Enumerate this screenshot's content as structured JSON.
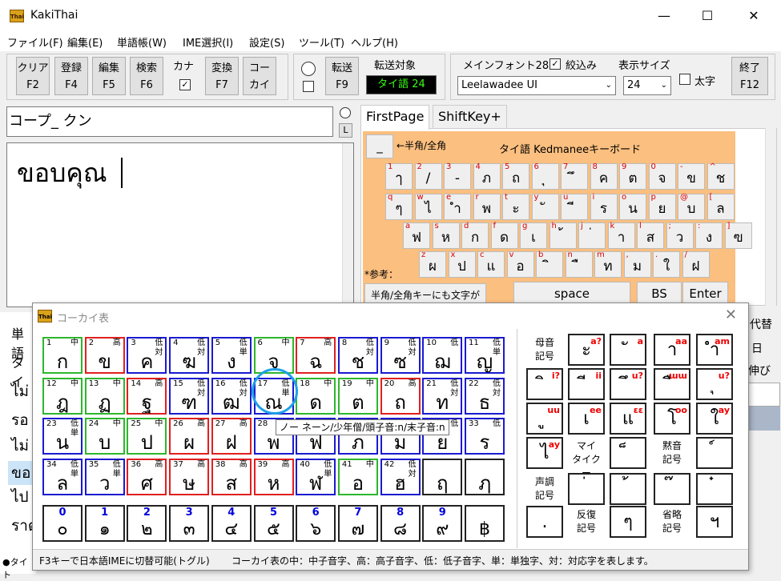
{
  "window": {
    "app_icon": "Thai",
    "title": "KakiThai",
    "min": "—",
    "max": "☐",
    "close": "✕"
  },
  "menu": [
    "ファイル(F)",
    "編集(E)",
    "単語帳(W)",
    "IME選択(I)",
    "設定(S)",
    "ツール(T)",
    "ヘルプ(H)"
  ],
  "toolbar": {
    "clear": [
      "クリア",
      "F2"
    ],
    "register": [
      "登録",
      "F4"
    ],
    "edit": [
      "編集",
      "F5"
    ],
    "search": [
      "検索",
      "F6"
    ],
    "kana": "カナ",
    "convert": [
      "変換",
      "F7"
    ],
    "kokai": [
      "コー",
      "カイ"
    ],
    "transfer": [
      "転送",
      "F9"
    ],
    "transfer_target_label": "転送対象",
    "transfer_target": "タイ語 24",
    "main_font_label": "メインフォント28",
    "filter_label": "絞込み",
    "font_value": "Leelawadee UI",
    "display_size_label": "表示サイズ",
    "size_value": "24",
    "bold_label": "太字",
    "exit": [
      "終了",
      "F12"
    ]
  },
  "input": {
    "reading": "コープ_ クン",
    "l_button": "L",
    "editor_text": "ขอบคุณ"
  },
  "tabs": [
    "FirstPage",
    "ShiftKey+"
  ],
  "keyboard": {
    "toggle_btn": "_",
    "hankaku_label": "←半角/全角",
    "title": "タイ語 Kedmaneeキーボード",
    "reference": "*参考：",
    "hankaku_note": "半角/全角キーにも文字が",
    "space": "space",
    "bs": "BS",
    "enter": "Enter",
    "row1": [
      [
        "1",
        "ๅ"
      ],
      [
        "2",
        "/"
      ],
      [
        "3",
        "-"
      ],
      [
        "4",
        "ภ"
      ],
      [
        "5",
        "ถ"
      ],
      [
        "6",
        "ุ"
      ],
      [
        "7",
        "ึ"
      ],
      [
        "8",
        "ค"
      ],
      [
        "9",
        "ต"
      ],
      [
        "0",
        "จ"
      ],
      [
        "-",
        "ข"
      ],
      [
        "^",
        "ช"
      ]
    ],
    "row2": [
      [
        "q",
        "ๆ"
      ],
      [
        "w",
        "ไ"
      ],
      [
        "e",
        "ำ"
      ],
      [
        "r",
        "พ"
      ],
      [
        "t",
        "ะ"
      ],
      [
        "y",
        "ั"
      ],
      [
        "u",
        "ี"
      ],
      [
        "i",
        "ร"
      ],
      [
        "o",
        "น"
      ],
      [
        "p",
        "ย"
      ],
      [
        "@",
        "บ"
      ],
      [
        "[",
        "ล"
      ]
    ],
    "row3": [
      [
        "a",
        "ฟ"
      ],
      [
        "s",
        "ห"
      ],
      [
        "d",
        "ก"
      ],
      [
        "f",
        "ด"
      ],
      [
        "g",
        "เ"
      ],
      [
        "h",
        "้"
      ],
      [
        "j",
        "่"
      ],
      [
        "k",
        "า"
      ],
      [
        "l",
        "ส"
      ],
      [
        ";",
        "ว"
      ],
      [
        ":",
        "ง"
      ],
      [
        "]",
        "ฃ"
      ]
    ],
    "row4": [
      [
        "z",
        "ผ"
      ],
      [
        "x",
        "ป"
      ],
      [
        "c",
        "แ"
      ],
      [
        "v",
        "อ"
      ],
      [
        "b",
        "ิ"
      ],
      [
        "n",
        "ื"
      ],
      [
        "m",
        "ท"
      ],
      [
        ",",
        "ม"
      ],
      [
        ".",
        "ใ"
      ],
      [
        "/",
        "ฝ"
      ]
    ]
  },
  "left_list": [
    "単語",
    "タイ",
    "ไม่",
    "รอ",
    "ไม่",
    "ขอ",
    "ไป",
    "ราต",
    "●タイト"
  ],
  "right_strip": [
    "代替",
    "日",
    "伸び"
  ],
  "dialog": {
    "title": "コーカイ表",
    "consonants": [
      [
        "1",
        "中",
        "ก",
        "G"
      ],
      [
        "2",
        "高",
        "ข",
        "R"
      ],
      [
        "3",
        "低対",
        "ค",
        "B"
      ],
      [
        "4",
        "低対",
        "ฆ",
        "B"
      ],
      [
        "5",
        "低単",
        "ง",
        "B"
      ],
      [
        "6",
        "中",
        "จ",
        "G"
      ],
      [
        "7",
        "高",
        "ฉ",
        "R"
      ],
      [
        "8",
        "低対",
        "ช",
        "B"
      ],
      [
        "9",
        "低対",
        "ซ",
        "B"
      ],
      [
        "10",
        "低",
        "ฌ",
        "B"
      ],
      [
        "11",
        "低単",
        "ญ",
        "B"
      ],
      [
        "12",
        "中",
        "ฎ",
        "G"
      ],
      [
        "13",
        "中",
        "ฏ",
        "G"
      ],
      [
        "14",
        "高",
        "ฐ",
        "R"
      ],
      [
        "15",
        "低対",
        "ฑ",
        "B"
      ],
      [
        "16",
        "低対",
        "ฒ",
        "B"
      ],
      [
        "17",
        "低単",
        "ณ",
        "B"
      ],
      [
        "18",
        "中",
        "ด",
        "G"
      ],
      [
        "19",
        "中",
        "ต",
        "G"
      ],
      [
        "20",
        "高",
        "ถ",
        "R"
      ],
      [
        "21",
        "低対",
        "ท",
        "B"
      ],
      [
        "22",
        "低対",
        "ธ",
        "B"
      ],
      [
        "23",
        "低単",
        "น",
        "B"
      ],
      [
        "24",
        "中",
        "บ",
        "G"
      ],
      [
        "25",
        "中",
        "ป",
        "G"
      ],
      [
        "26",
        "高",
        "ผ",
        "R"
      ],
      [
        "27",
        "高",
        "ฝ",
        "R"
      ],
      [
        "28",
        "低",
        "พ",
        "B"
      ],
      [
        "29",
        "低",
        "ฟ",
        "B"
      ],
      [
        "30",
        "低",
        "ภ",
        "B"
      ],
      [
        "31",
        "低",
        "ม",
        "B"
      ],
      [
        "32",
        "低",
        "ย",
        "B"
      ],
      [
        "33",
        "低",
        "ร",
        "B"
      ],
      [
        "34",
        "低単",
        "ล",
        "B"
      ],
      [
        "35",
        "低単",
        "ว",
        "B"
      ],
      [
        "36",
        "高",
        "ศ",
        "R"
      ],
      [
        "37",
        "高",
        "ษ",
        "R"
      ],
      [
        "38",
        "高",
        "ส",
        "R"
      ],
      [
        "39",
        "高",
        "ห",
        "R"
      ],
      [
        "40",
        "低単",
        "ฬ",
        "B"
      ],
      [
        "41",
        "中",
        "อ",
        "G"
      ],
      [
        "42",
        "低対",
        "ฮ",
        "B"
      ],
      [
        "",
        "",
        "ฤ",
        "K"
      ],
      [
        "",
        "",
        "ฦ",
        "K"
      ]
    ],
    "digits": [
      [
        "0",
        "๐"
      ],
      [
        "1",
        "๑"
      ],
      [
        "2",
        "๒"
      ],
      [
        "3",
        "๓"
      ],
      [
        "4",
        "๔"
      ],
      [
        "5",
        "๕"
      ],
      [
        "6",
        "๖"
      ],
      [
        "7",
        "๗"
      ],
      [
        "8",
        "๘"
      ],
      [
        "9",
        "๙"
      ],
      [
        "",
        "฿"
      ]
    ],
    "vowel_label": [
      "母音",
      "記号"
    ],
    "vowels": [
      [
        "ะ",
        "a?"
      ],
      [
        "ั",
        "a"
      ],
      [
        "า",
        "aa"
      ],
      [
        "ำ",
        "am"
      ],
      [
        "ิ",
        "i?"
      ],
      [
        "ี",
        "ii"
      ],
      [
        "ึ",
        "u?"
      ],
      [
        "ื",
        "ɯɯ"
      ],
      [
        "ุ",
        "u?"
      ],
      [
        "ู",
        "uu"
      ],
      [
        "เ",
        "ee"
      ],
      [
        "แ",
        "ɛɛ"
      ],
      [
        "โ",
        "oo"
      ],
      [
        "ใ",
        "ay"
      ],
      [
        "ไ",
        "ay"
      ]
    ],
    "mai_taiku": [
      "マイ",
      "タイクー"
    ],
    "silent_label": [
      "黙音",
      "記号"
    ],
    "tone_label": [
      "声調",
      "記号"
    ],
    "repeat_label": [
      "反復",
      "記号"
    ],
    "abbr_label": [
      "省略",
      "記号"
    ],
    "tooltip": "ノー ネーン/少年僧/頭子音:n/末子音:n",
    "status_left": "F3キーで日本語IMEに切替可能(トグル)",
    "status_right": "コーカイ表の中：中子音字、高：高子音字、低：低子音字、単：単独字、対：対応字を表します。"
  }
}
